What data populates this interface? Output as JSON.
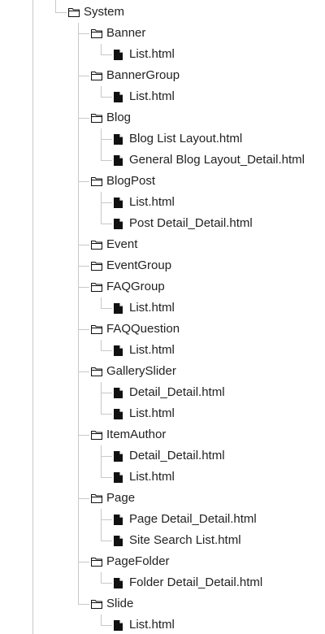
{
  "tree": {
    "root": {
      "label": "System",
      "icon": "folder-icon"
    },
    "folders": [
      {
        "label": "Banner",
        "icon": "folder-icon",
        "files": [
          "List.html"
        ]
      },
      {
        "label": "BannerGroup",
        "icon": "folder-icon",
        "files": [
          "List.html"
        ]
      },
      {
        "label": "Blog",
        "icon": "folder-icon",
        "files": [
          "Blog List Layout.html",
          "General Blog Layout_Detail.html"
        ]
      },
      {
        "label": "BlogPost",
        "icon": "folder-icon",
        "files": [
          "List.html",
          "Post Detail_Detail.html"
        ]
      },
      {
        "label": "Event",
        "icon": "folder-icon",
        "files": []
      },
      {
        "label": "EventGroup",
        "icon": "folder-icon",
        "files": []
      },
      {
        "label": "FAQGroup",
        "icon": "folder-icon",
        "files": [
          "List.html"
        ]
      },
      {
        "label": "FAQQuestion",
        "icon": "folder-icon",
        "files": [
          "List.html"
        ]
      },
      {
        "label": "GallerySlider",
        "icon": "folder-icon",
        "files": [
          "Detail_Detail.html",
          "List.html"
        ]
      },
      {
        "label": "ItemAuthor",
        "icon": "folder-icon",
        "files": [
          "Detail_Detail.html",
          "List.html"
        ]
      },
      {
        "label": "Page",
        "icon": "folder-icon",
        "files": [
          "Page Detail_Detail.html",
          "Site Search List.html"
        ]
      },
      {
        "label": "PageFolder",
        "icon": "folder-icon",
        "files": [
          "Folder Detail_Detail.html"
        ]
      },
      {
        "label": "Slide",
        "icon": "folder-icon",
        "files": [
          "List.html"
        ]
      }
    ],
    "file_icon": "file-icon"
  }
}
